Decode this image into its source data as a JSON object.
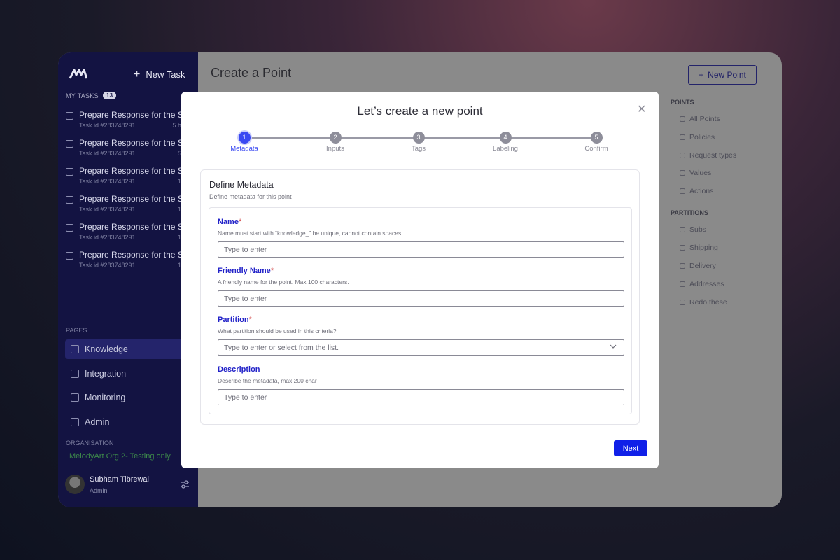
{
  "sidebar": {
    "new_task_label": "New Task",
    "my_tasks_label": "MY TASKS",
    "my_tasks_count": "13",
    "tasks": [
      {
        "title": "Prepare Response for the S",
        "id": "Task id #283748291",
        "meta": "5 h"
      },
      {
        "title": "Prepare Response for the S",
        "id": "Task id #283748291",
        "meta": "5"
      },
      {
        "title": "Prepare Response for the S",
        "id": "Task id #283748291",
        "meta": "1"
      },
      {
        "title": "Prepare Response for the S",
        "id": "Task id #283748291",
        "meta": "1"
      },
      {
        "title": "Prepare Response for the S",
        "id": "Task id #283748291",
        "meta": "1"
      },
      {
        "title": "Prepare Response for the S",
        "id": "Task id #283748291",
        "meta": "1"
      }
    ],
    "pages_label": "PAGES",
    "nav": [
      {
        "label": "Knowledge",
        "icon": "book-icon"
      },
      {
        "label": "Integration",
        "icon": "grid-icon"
      },
      {
        "label": "Monitoring",
        "icon": "monitor-icon"
      },
      {
        "label": "Admin",
        "icon": "sliders-icon"
      }
    ],
    "organisation_label": "ORGANISATION",
    "organisation_name": "MelodyArt Org 2- Testing only",
    "user_name": "Subham Tibrewal",
    "user_role": "Admin"
  },
  "main": {
    "title": "Create a Point"
  },
  "right_panel": {
    "new_point_label": "New Point",
    "points_label": "POINTS",
    "points": [
      "All Points",
      "Policies",
      "Request types",
      "Values",
      "Actions"
    ],
    "partitions_label": "PARTITIONS",
    "partitions": [
      "Subs",
      "Shipping",
      "Delivery",
      "Addresses",
      "Redo these"
    ]
  },
  "modal": {
    "title": "Let’s create a new point",
    "steps": [
      {
        "num": "1",
        "label": "Metadata",
        "active": true
      },
      {
        "num": "2",
        "label": "Inputs",
        "active": false
      },
      {
        "num": "3",
        "label": "Tags",
        "active": false
      },
      {
        "num": "4",
        "label": "Labeling",
        "active": false
      },
      {
        "num": "5",
        "label": "Confirm",
        "active": false
      }
    ],
    "card_title": "Define Metadata",
    "card_subtitle": "Define metadata for this point",
    "fields": {
      "name": {
        "label": "Name",
        "required": "*",
        "help": "Name must start with “knowledge_” be unique, cannot contain spaces.",
        "placeholder": "Type to enter",
        "value": ""
      },
      "friendly_name": {
        "label": "Friendly Name",
        "required": "*",
        "help": "A friendly name for the point. Max 100 characters.",
        "placeholder": "Type to enter",
        "value": ""
      },
      "partition": {
        "label": "Partition",
        "required": "*",
        "help": "What partition should be used in this criteria?",
        "placeholder": "Type to enter or select from the list."
      },
      "description": {
        "label": "Description",
        "help": "Describe the metadata, max 200 char",
        "placeholder": "Type to enter",
        "value": ""
      }
    },
    "next_label": "Next"
  },
  "colors": {
    "sidebar_bg": "#131342",
    "accent": "#1020e8",
    "step_active": "#3a49f2",
    "label_blue": "#2222c8"
  }
}
